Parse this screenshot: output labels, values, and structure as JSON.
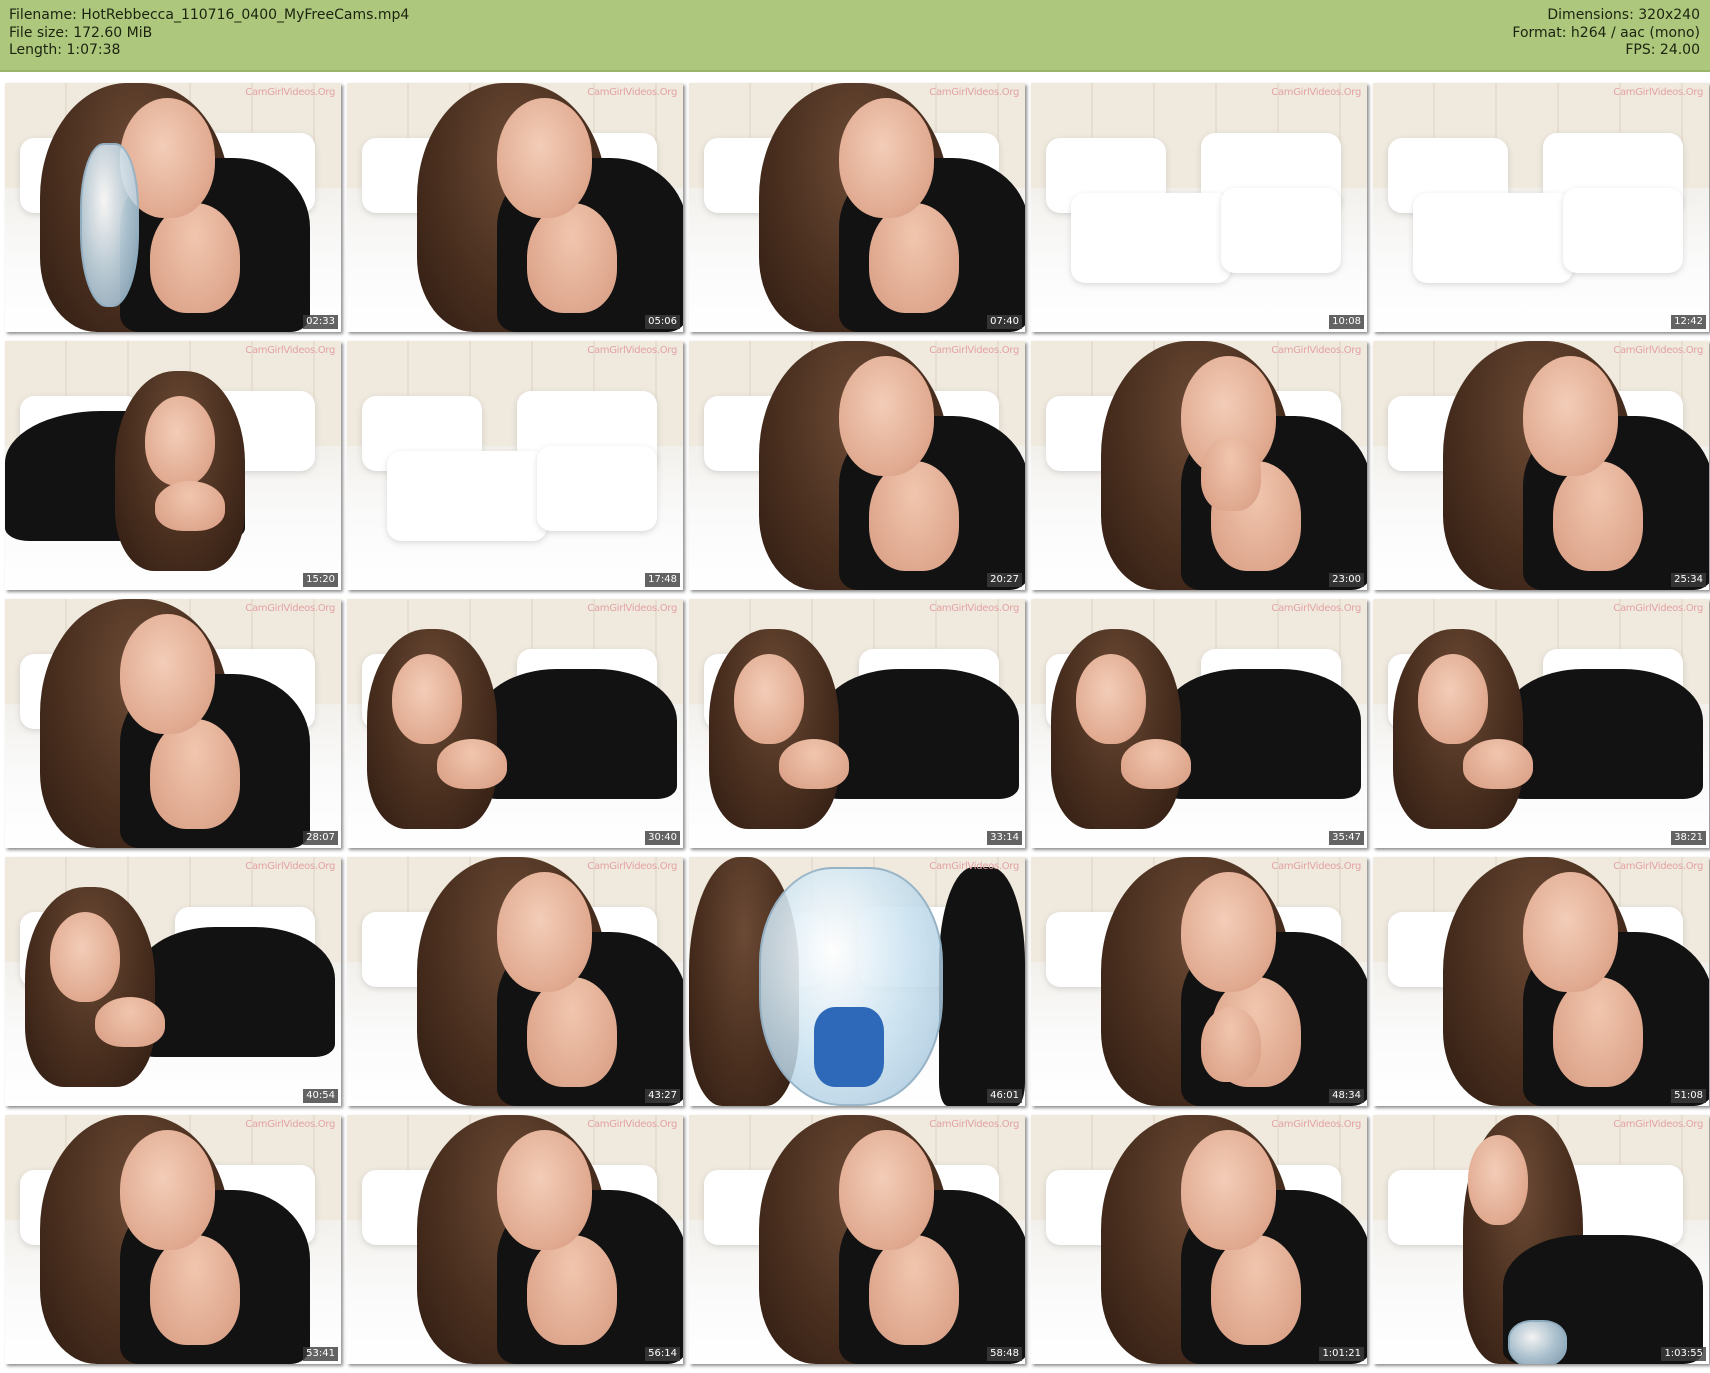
{
  "header": {
    "left": [
      "Filename: HotRebbecca_110716_0400_MyFreeCams.mp4",
      "File size: 172.60 MiB",
      "Length: 1:07:38"
    ],
    "right": [
      "Dimensions: 320x240",
      "Format: h264 / aac (mono)",
      "FPS: 24.00"
    ]
  },
  "watermark": "CamGirlVideos.Org",
  "thumbnails": [
    {
      "time": "02:33",
      "scene": "drinking-glass"
    },
    {
      "time": "05:06",
      "scene": "woman-smiling"
    },
    {
      "time": "07:40",
      "scene": "woman-center"
    },
    {
      "time": "10:08",
      "scene": "empty-bed"
    },
    {
      "time": "12:42",
      "scene": "empty-bed"
    },
    {
      "time": "15:20",
      "scene": "woman-lying-left"
    },
    {
      "time": "17:48",
      "scene": "empty-bed-bright"
    },
    {
      "time": "20:27",
      "scene": "woman-center"
    },
    {
      "time": "23:00",
      "scene": "woman-hand-face"
    },
    {
      "time": "25:34",
      "scene": "woman-center"
    },
    {
      "time": "28:07",
      "scene": "woman-left"
    },
    {
      "time": "30:40",
      "scene": "woman-lying-right"
    },
    {
      "time": "33:14",
      "scene": "woman-lying-right"
    },
    {
      "time": "35:47",
      "scene": "woman-lying-right"
    },
    {
      "time": "38:21",
      "scene": "woman-lying-right"
    },
    {
      "time": "40:54",
      "scene": "woman-lying-right"
    },
    {
      "time": "43:27",
      "scene": "woman-leaning"
    },
    {
      "time": "46:01",
      "scene": "bottle-closeup"
    },
    {
      "time": "48:34",
      "scene": "woman-hand-chest"
    },
    {
      "time": "51:08",
      "scene": "woman-center"
    },
    {
      "time": "53:41",
      "scene": "woman-left"
    },
    {
      "time": "56:14",
      "scene": "woman-center"
    },
    {
      "time": "58:48",
      "scene": "woman-center"
    },
    {
      "time": "1:01:21",
      "scene": "woman-center"
    },
    {
      "time": "1:03:55",
      "scene": "woman-profile-glass"
    }
  ]
}
